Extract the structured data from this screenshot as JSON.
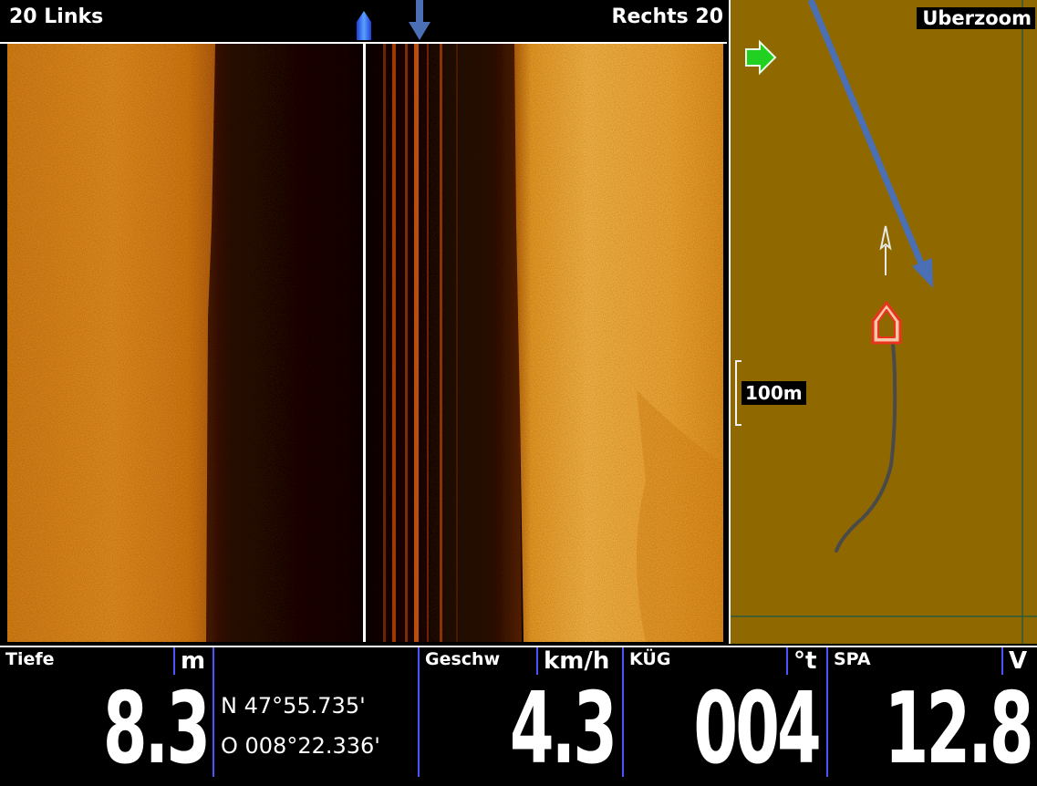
{
  "sonar": {
    "left_label": "20 Links",
    "right_label": "Rechts 20"
  },
  "map": {
    "title": "Uberzoom",
    "scale": "100m"
  },
  "data_bar": {
    "depth": {
      "title": "Tiefe",
      "unit": "m",
      "value": "8.3"
    },
    "position": {
      "lat": "N 47°55.735'",
      "lon": "O 008°22.336'"
    },
    "speed": {
      "title": "Geschw",
      "unit": "km/h",
      "value": "4.3"
    },
    "course": {
      "title": "KÜG",
      "unit": "°t",
      "value": "004"
    },
    "voltage": {
      "title": "SPA",
      "unit": "V",
      "value": "12.8"
    }
  },
  "colors": {
    "sonar_bright": "#f2a632",
    "sonar_dark": "#1a0600",
    "map_bg": "#8f6900",
    "annotation_arrow": "#4a6fb5",
    "separator_blue": "#4a55ff",
    "boat_red": "#e8341c",
    "track": "#4a4a4a",
    "next_arrow_green": "#22d022"
  },
  "icons": [
    "boat-marker-icon",
    "annotation-arrow-icon",
    "green-arrow-icon",
    "boat-position-icon",
    "north-arrow-icon"
  ]
}
